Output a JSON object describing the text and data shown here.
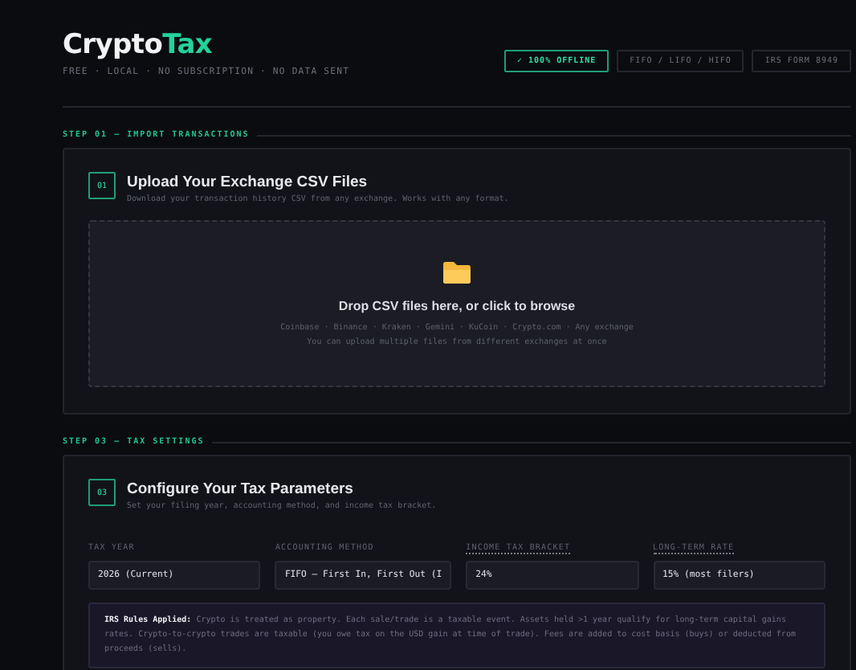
{
  "header": {
    "logo": {
      "prefix": "Crypto",
      "accent": "Tax"
    },
    "tagline": "FREE · LOCAL · NO SUBSCRIPTION · NO DATA SENT",
    "badges": [
      {
        "label": "✓ 100% OFFLINE",
        "selected": true
      },
      {
        "label": "FIFO / LIFO / HIFO",
        "selected": false
      },
      {
        "label": "IRS FORM 8949",
        "selected": false
      }
    ]
  },
  "steps": [
    {
      "label": "STEP 01 — IMPORT TRANSACTIONS",
      "number": "01",
      "title": "Upload Your Exchange CSV Files",
      "description": "Download your transaction history CSV from any exchange. Works with any format.",
      "kind": "upload",
      "dropzone": {
        "title": "Drop CSV files here, or click to browse",
        "exchanges": "Coinbase · Binance · Kraken · Gemini · KuCoin · Crypto.com · Any exchange",
        "hint": "You can upload multiple files from different exchanges at once"
      }
    },
    {
      "label": "STEP 03 — TAX SETTINGS",
      "number": "03",
      "title": "Configure Your Tax Parameters",
      "description": "Set your filing year, accounting method, and income tax bracket.",
      "kind": "settings",
      "fields": [
        {
          "label": "TAX YEAR",
          "value": "2026 (Current)",
          "tooltip": false
        },
        {
          "label": "ACCOUNTING METHOD",
          "value": "FIFO — First In, First Out (I",
          "tooltip": false
        },
        {
          "label": "INCOME TAX BRACKET",
          "value": "24%",
          "tooltip": true
        },
        {
          "label": "LONG-TERM RATE",
          "value": "15% (most filers)",
          "tooltip": true
        }
      ],
      "note": "**IRS Rules Applied:** Crypto is treated as property. Each sale/trade is a taxable event. Assets held >1 year qualify for long-term capital gains rates. Crypto-to-crypto trades are taxable (you owe tax on the USD gain at time of trade). Fees are added to cost basis (buys) or deducted from proceeds (sells)."
    }
  ]
}
